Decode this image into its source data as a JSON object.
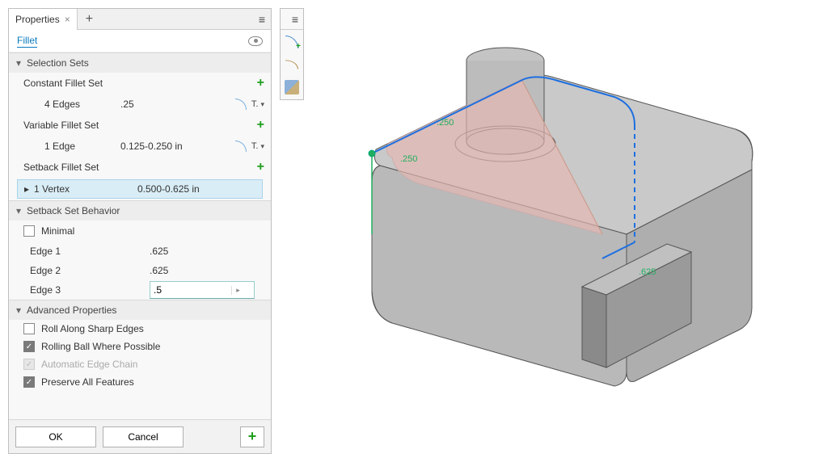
{
  "tabs": {
    "properties": "Properties"
  },
  "feature": {
    "name": "Fillet"
  },
  "sections": {
    "selection_sets": "Selection Sets",
    "constant_set": "Constant Fillet Set",
    "variable_set": "Variable Fillet Set",
    "setback_set": "Setback Fillet Set",
    "setback_behavior": "Setback Set Behavior",
    "advanced": "Advanced Properties"
  },
  "constant": {
    "edges": "4 Edges",
    "value": ".25",
    "type_short": "T."
  },
  "variable": {
    "edges": "1 Edge",
    "value": "0.125-0.250 in",
    "type_short": "T."
  },
  "setback": {
    "vertex": "1 Vertex",
    "value": "0.500-0.625 in"
  },
  "behavior": {
    "minimal": {
      "label": "Minimal",
      "checked": false
    },
    "edge1": {
      "label": "Edge 1",
      "value": ".625"
    },
    "edge2": {
      "label": "Edge 2",
      "value": ".625"
    },
    "edge3": {
      "label": "Edge 3",
      "value": ".5"
    }
  },
  "advanced": {
    "roll_sharp": {
      "label": "Roll Along Sharp Edges",
      "checked": false
    },
    "rolling_ball": {
      "label": "Rolling Ball Where Possible",
      "checked": true
    },
    "auto_chain": {
      "label": "Automatic Edge Chain",
      "checked": true,
      "disabled": true
    },
    "preserve": {
      "label": "Preserve All Features",
      "checked": true
    }
  },
  "footer": {
    "ok": "OK",
    "cancel": "Cancel"
  },
  "viewport": {
    "dim1": ".250",
    "dim2": ".250",
    "dim3": ".625"
  }
}
